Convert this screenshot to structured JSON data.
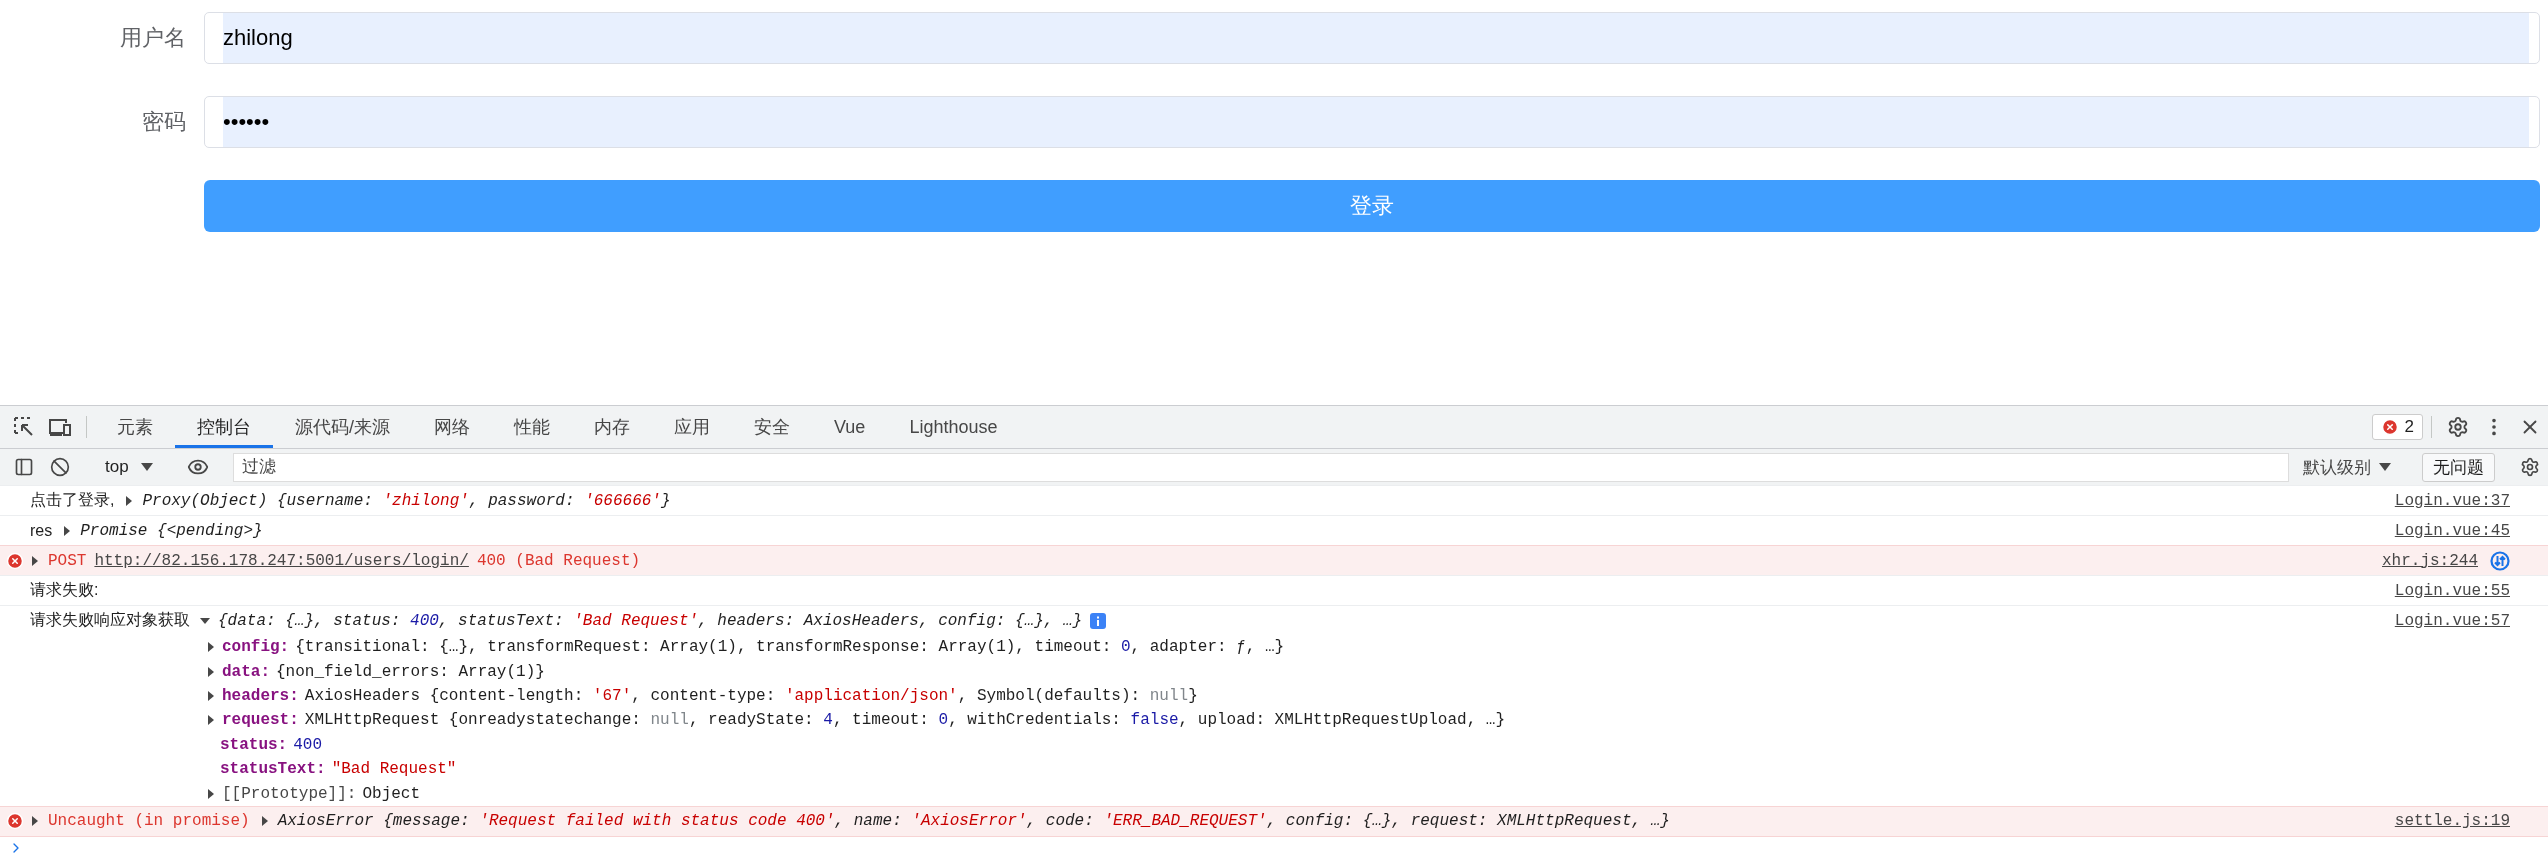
{
  "login_form": {
    "fields": [
      {
        "label": "用户名",
        "value": "zhilong"
      },
      {
        "label": "密码",
        "value": "••••••"
      }
    ],
    "submit": "登录"
  },
  "devtools": {
    "tabs": [
      {
        "label": "元素",
        "selected": false
      },
      {
        "label": "控制台",
        "selected": true
      },
      {
        "label": "源代码/来源",
        "selected": false
      },
      {
        "label": "网络",
        "selected": false
      },
      {
        "label": "性能",
        "selected": false
      },
      {
        "label": "内存",
        "selected": false
      },
      {
        "label": "应用",
        "selected": false
      },
      {
        "label": "安全",
        "selected": false
      },
      {
        "label": "Vue",
        "selected": false
      },
      {
        "label": "Lighthouse",
        "selected": false
      }
    ],
    "error_count": "2",
    "toolbar": {
      "context": "top",
      "filter_placeholder": "过滤",
      "level": "默认级别",
      "issues": "无问题"
    },
    "messages": [
      {
        "kind": "log",
        "source": "Login.vue:37",
        "parts": [
          {
            "kind": "label",
            "text": "点击了登录,"
          },
          {
            "kind": "arrow",
            "expanded": false
          },
          {
            "kind": "object",
            "tokens": [
              {
                "kind": "plain",
                "text": "Proxy(Object) {username: "
              },
              {
                "kind": "string",
                "text": "'zhilong'"
              },
              {
                "kind": "plain",
                "text": ", password: "
              },
              {
                "kind": "string",
                "text": "'666666'"
              },
              {
                "kind": "plain",
                "text": "}"
              }
            ]
          }
        ]
      },
      {
        "kind": "log",
        "source": "Login.vue:45",
        "parts": [
          {
            "kind": "label",
            "text": "res"
          },
          {
            "kind": "arrow",
            "expanded": false
          },
          {
            "kind": "object",
            "tokens": [
              {
                "kind": "plain",
                "text": "Promise {<pending>}"
              }
            ]
          }
        ]
      },
      {
        "kind": "error",
        "source": "xhr.js:244",
        "network_request": true,
        "parts": [
          {
            "kind": "arrow",
            "expanded": false
          },
          {
            "kind": "label",
            "text": "POST"
          },
          {
            "kind": "link",
            "text": "http://82.156.178.247:5001/users/login/"
          },
          {
            "kind": "label",
            "text": "400 (Bad Request)"
          }
        ]
      },
      {
        "kind": "log",
        "source": "Login.vue:55",
        "parts": [
          {
            "kind": "label",
            "text": "请求失败:"
          }
        ]
      },
      {
        "kind": "log",
        "source": "Login.vue:57",
        "parts": [
          {
            "kind": "label",
            "text": "请求失败响应对象获取"
          },
          {
            "kind": "arrow",
            "expanded": true
          },
          {
            "kind": "object",
            "info": true,
            "tokens": [
              {
                "kind": "plain",
                "text": "{data: {…}, status: "
              },
              {
                "kind": "number",
                "text": "400"
              },
              {
                "kind": "plain",
                "text": ", statusText: "
              },
              {
                "kind": "string",
                "text": "'Bad Request'"
              },
              {
                "kind": "plain",
                "text": ", headers: AxiosHeaders, config: {…}, …}"
              }
            ],
            "children": [
              {
                "kind": "object",
                "expanded": false,
                "name": "config:",
                "tokens": [
                  {
                    "kind": "plain",
                    "text": "{transitional: {…}, transformRequest: Array(1), transformResponse: Array(1), timeout: "
                  },
                  {
                    "kind": "number",
                    "text": "0"
                  },
                  {
                    "kind": "plain",
                    "text": ", adapter: ƒ, …}"
                  }
                ]
              },
              {
                "kind": "object",
                "expanded": false,
                "name": "data:",
                "tokens": [
                  {
                    "kind": "plain",
                    "text": "{non_field_errors: Array(1)}"
                  }
                ]
              },
              {
                "kind": "object",
                "expanded": false,
                "name": "headers:",
                "tokens": [
                  {
                    "kind": "plain",
                    "text": "AxiosHeaders {content-length: "
                  },
                  {
                    "kind": "string",
                    "text": "'67'"
                  },
                  {
                    "kind": "plain",
                    "text": ", content-type: "
                  },
                  {
                    "kind": "string",
                    "text": "'application/json'"
                  },
                  {
                    "kind": "plain",
                    "text": ", Symbol(defaults): "
                  },
                  {
                    "kind": "null",
                    "text": "null"
                  },
                  {
                    "kind": "plain",
                    "text": "}"
                  }
                ]
              },
              {
                "kind": "object",
                "expanded": false,
                "name": "request:",
                "tokens": [
                  {
                    "kind": "plain",
                    "text": "XMLHttpRequest {onreadystatechange: "
                  },
                  {
                    "kind": "null",
                    "text": "null"
                  },
                  {
                    "kind": "plain",
                    "text": ", readyState: "
                  },
                  {
                    "kind": "number",
                    "text": "4"
                  },
                  {
                    "kind": "plain",
                    "text": ", timeout: "
                  },
                  {
                    "kind": "number",
                    "text": "0"
                  },
                  {
                    "kind": "plain",
                    "text": ", withCredentials: "
                  },
                  {
                    "kind": "bool",
                    "text": "false"
                  },
                  {
                    "kind": "plain",
                    "text": ", upload: XMLHttpRequestUpload, …}"
                  }
                ]
              },
              {
                "kind": "value",
                "name": "status:",
                "tokens": [
                  {
                    "kind": "number",
                    "text": "400"
                  }
                ]
              },
              {
                "kind": "value",
                "name": "statusText:",
                "tokens": [
                  {
                    "kind": "string",
                    "text": "\"Bad Request\""
                  }
                ]
              },
              {
                "kind": "internal",
                "expanded": false,
                "name": "[[Prototype]]:",
                "tokens": [
                  {
                    "kind": "plain",
                    "text": "Object"
                  }
                ]
              }
            ]
          }
        ]
      },
      {
        "kind": "error",
        "source": "settle.js:19",
        "parts": [
          {
            "kind": "arrow",
            "expanded": false
          },
          {
            "kind": "label",
            "text": "Uncaught (in promise)"
          },
          {
            "kind": "arrow",
            "expanded": false
          },
          {
            "kind": "object",
            "tokens": [
              {
                "kind": "plain",
                "text": "AxiosError {message: "
              },
              {
                "kind": "string",
                "text": "'Request failed with status code 400'"
              },
              {
                "kind": "plain",
                "text": ", name: "
              },
              {
                "kind": "string",
                "text": "'AxiosError'"
              },
              {
                "kind": "plain",
                "text": ", code: "
              },
              {
                "kind": "string",
                "text": "'ERR_BAD_REQUEST'"
              },
              {
                "kind": "plain",
                "text": ", config: {…}, request: XMLHttpRequest, …}"
              }
            ]
          }
        ]
      }
    ]
  }
}
